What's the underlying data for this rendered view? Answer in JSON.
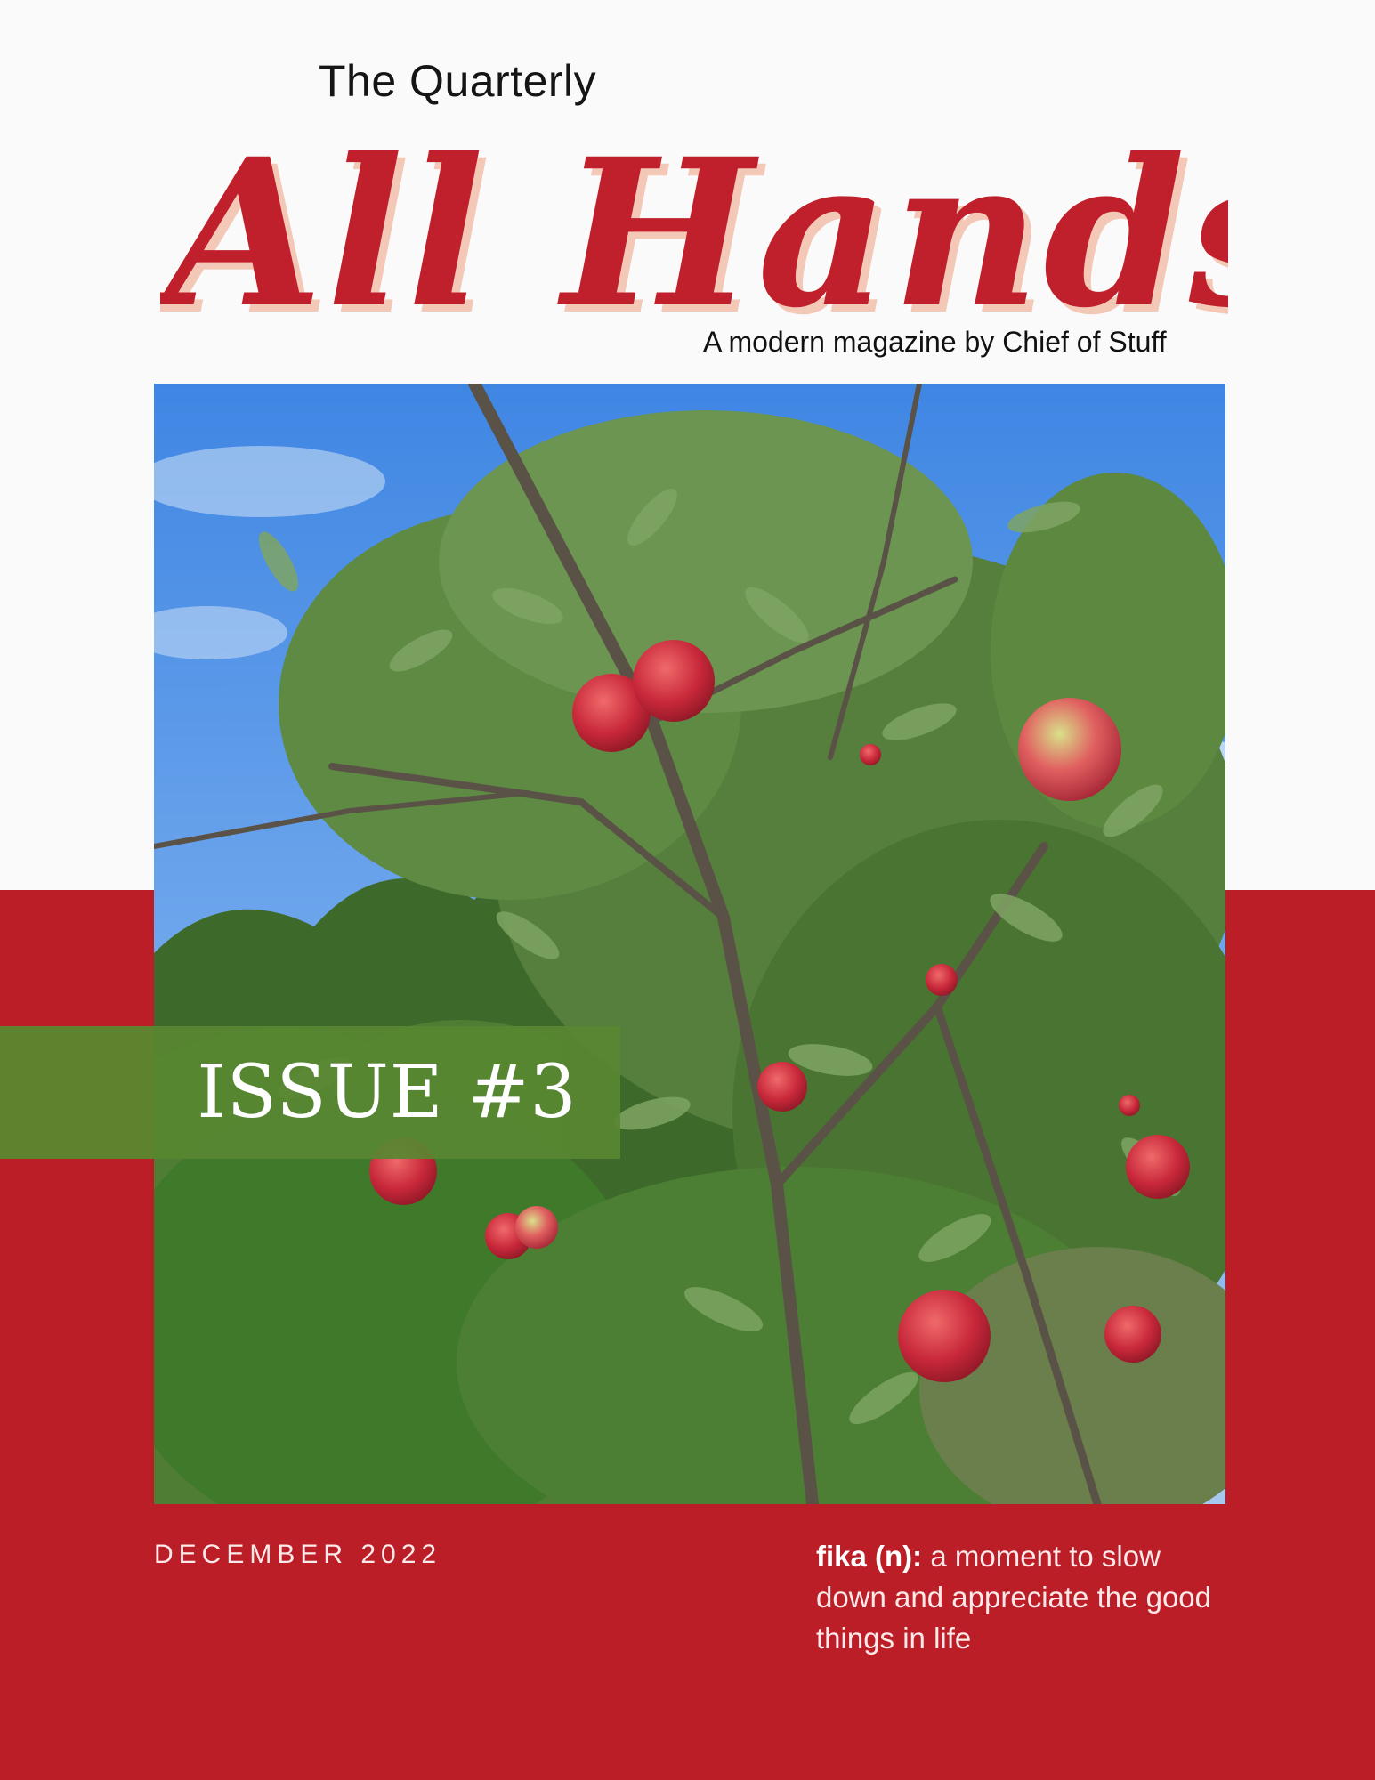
{
  "header": {
    "kicker": "The Quarterly",
    "title": "All Hands",
    "tagline": "A modern magazine by Chief of Stuff"
  },
  "cover": {
    "issue": "ISSUE #3",
    "date": "DECEMBER 2022",
    "definition_term": "fika (n):",
    "definition_text": " a moment to slow down and appreciate the good things in life"
  },
  "colors": {
    "brand_red": "#bb1e27",
    "title_red": "#c0202b",
    "issue_green": "#5e822e",
    "page_bg": "#fafafa"
  }
}
